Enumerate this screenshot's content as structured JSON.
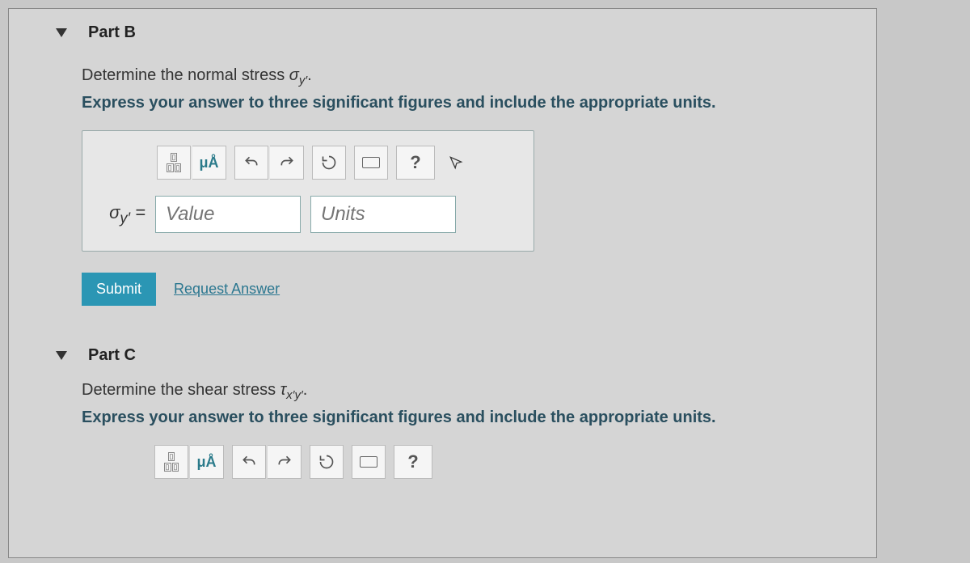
{
  "partB": {
    "title": "Part B",
    "prompt_prefix": "Determine the normal stress ",
    "prompt_symbol": "σ",
    "prompt_sub": "y′",
    "prompt_suffix": ".",
    "instruction": "Express your answer to three significant figures and include the appropriate units.",
    "var_label": "σy′ =",
    "value_placeholder": "Value",
    "units_placeholder": "Units",
    "submit_label": "Submit",
    "request_label": "Request Answer",
    "toolbar": {
      "format": "▯",
      "units_symbol": "μÅ",
      "undo": "↶",
      "redo": "↷",
      "reset": "↻",
      "keyboard": "⌨",
      "help": "?",
      "pointer": "↖"
    }
  },
  "partC": {
    "title": "Part C",
    "prompt_prefix": "Determine the shear stress ",
    "prompt_symbol": "τ",
    "prompt_sub": "x′y′",
    "prompt_suffix": ".",
    "instruction": "Express your answer to three significant figures and include the appropriate units.",
    "toolbar": {
      "format": "▯",
      "units_symbol": "μÅ",
      "undo": "↶",
      "redo": "↷",
      "reset": "↻",
      "keyboard": "⌨",
      "help": "?"
    }
  }
}
